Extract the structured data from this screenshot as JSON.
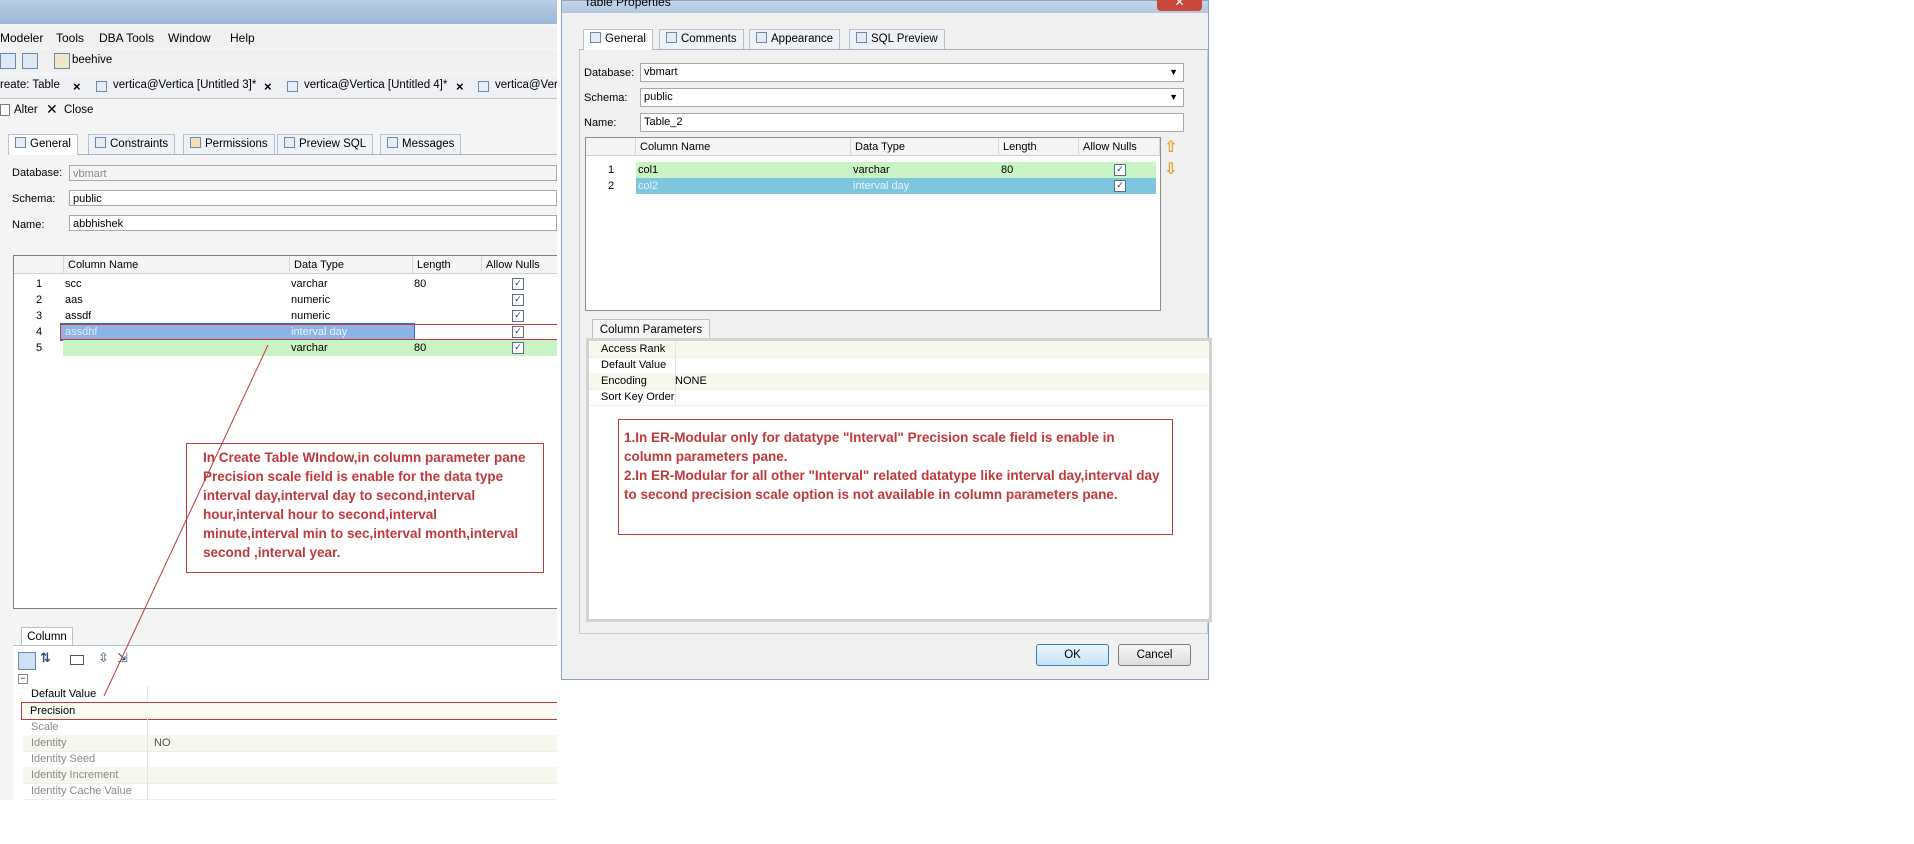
{
  "left_window": {
    "menu": [
      "Modeler",
      "Tools",
      "DBA Tools",
      "Window",
      "Help"
    ],
    "toolbar": {
      "connection": "beehive"
    },
    "doc_tabs": [
      "reate: Table",
      "vertica@Vertica [Untitled 3]*",
      "vertica@Vertica [Untitled 4]*",
      "vertica@Ver"
    ],
    "actions": {
      "alter": "Alter",
      "close": "Close"
    },
    "tabs": [
      "General",
      "Constraints",
      "Permissions",
      "Preview SQL",
      "Messages"
    ],
    "form": {
      "database_label": "Database:",
      "database_value": "vbmart",
      "schema_label": "Schema:",
      "schema_value": "public",
      "name_label": "Name:",
      "name_value": "abbhishek"
    },
    "grid": {
      "headers": [
        "Column Name",
        "Data Type",
        "Length",
        "Allow Nulls"
      ],
      "rows": [
        {
          "num": "1",
          "name": "scc",
          "type": "varchar",
          "length": "80",
          "nulls": true
        },
        {
          "num": "2",
          "name": "aas",
          "type": "numeric",
          "length": "",
          "nulls": true
        },
        {
          "num": "3",
          "name": "assdf",
          "type": "numeric",
          "length": "",
          "nulls": true
        },
        {
          "num": "4",
          "name": "assdhf",
          "type": "interval day",
          "length": "",
          "nulls": true
        },
        {
          "num": "5",
          "name": "",
          "type": "varchar",
          "length": "80",
          "nulls": true
        }
      ]
    },
    "annotation": "In Create Table WIndow,in column parameter pane Precision scale field is enable for the data type interval day,interval day to second,interval hour,interval hour to second,interval minute,interval min to sec,interval month,interval second ,interval year.",
    "column_panel": {
      "tab": "Column",
      "properties": [
        {
          "name": "Default Value",
          "value": ""
        },
        {
          "name": "Precision",
          "value": ""
        },
        {
          "name": "Scale",
          "value": ""
        },
        {
          "name": "Identity",
          "value": "NO"
        },
        {
          "name": "Identity Seed",
          "value": ""
        },
        {
          "name": "Identity Increment",
          "value": ""
        },
        {
          "name": "Identity Cache Value",
          "value": ""
        }
      ]
    }
  },
  "dialog": {
    "title": "Table Properties",
    "tabs": [
      "General",
      "Comments",
      "Appearance",
      "SQL Preview"
    ],
    "form": {
      "database_label": "Database:",
      "database_value": "vbmart",
      "schema_label": "Schema:",
      "schema_value": "public",
      "name_label": "Name:",
      "name_value": "Table_2"
    },
    "grid": {
      "headers": [
        "Column Name",
        "Data Type",
        "Length",
        "Allow Nulls"
      ],
      "rows": [
        {
          "num": "1",
          "name": "col1",
          "type": "varchar",
          "length": "80",
          "nulls": true
        },
        {
          "num": "2",
          "name": "col2",
          "type": "interval day",
          "length": "",
          "nulls": true
        }
      ]
    },
    "column_parameters": {
      "tab": "Column Parameters",
      "rows": [
        {
          "name": "Access Rank",
          "value": ""
        },
        {
          "name": "Default Value",
          "value": ""
        },
        {
          "name": "Encoding",
          "value": "NONE"
        },
        {
          "name": "Sort Key Order",
          "value": ""
        }
      ]
    },
    "annotation_line1": "1.In ER-Modular only for datatype \"Interval\" Precision scale field is enable in column parameters pane.",
    "annotation_line2": "2.In ER-Modular for all other \"Interval\" related datatype like interval day,interval day to second precision scale option is not available in column parameters pane.",
    "buttons": {
      "ok": "OK",
      "cancel": "Cancel"
    }
  }
}
